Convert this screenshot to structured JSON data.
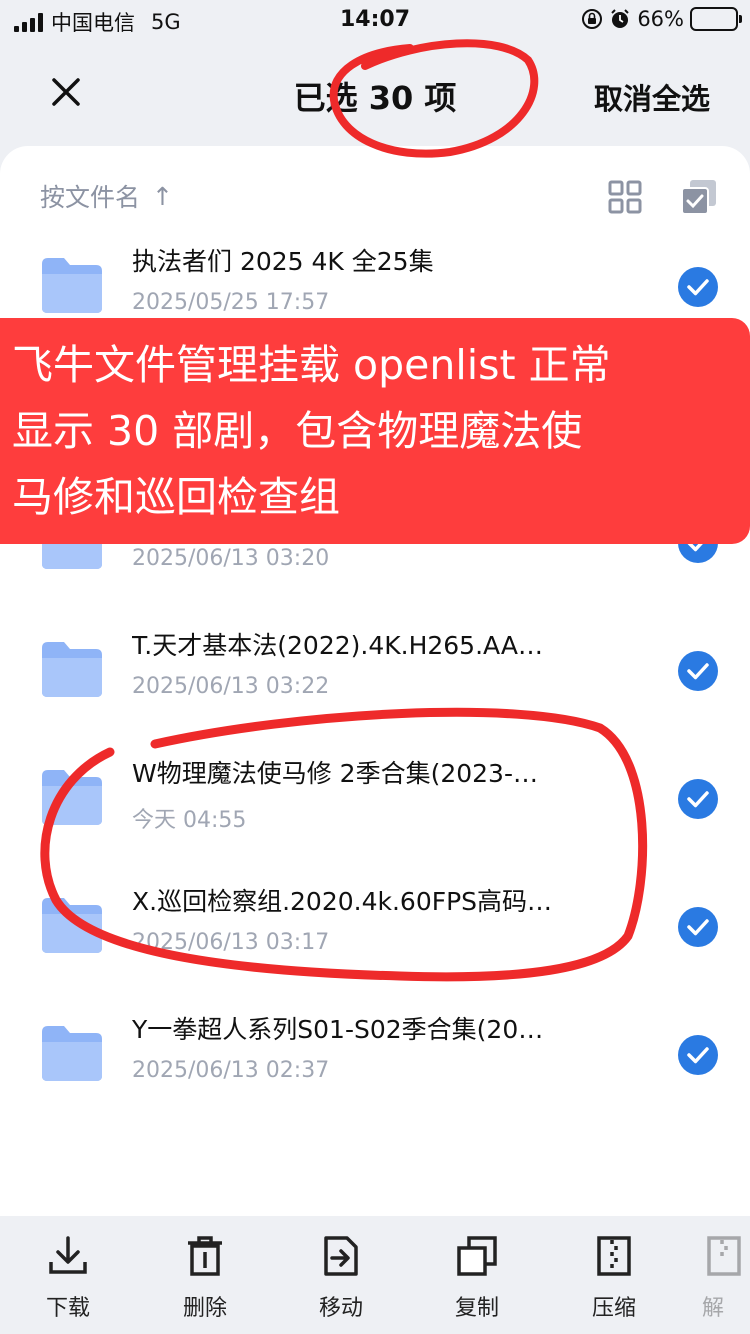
{
  "status": {
    "carrier": "中国电信",
    "network": "5G",
    "time": "14:07",
    "battery": "66%",
    "battery_level": 0.66
  },
  "header": {
    "title": "已选 30 项",
    "cancel_label": "取消全选"
  },
  "sortbar": {
    "label": "按文件名",
    "arrow": "↑"
  },
  "files": [
    {
      "name": "执法者们 2025 4K 全25集",
      "date": "2025/05/25 17:57"
    },
    {
      "name": "",
      "date": "2025/06/13 03:20"
    },
    {
      "name": "T.天才基本法(2022).4K.H265.AA…",
      "date": "2025/06/13 03:22"
    },
    {
      "name": "W物理魔法使马修 2季合集(2023-…",
      "date": "今天 04:55"
    },
    {
      "name": "X.巡回检察组.2020.4k.60FPS高码…",
      "date": "2025/06/13 03:17"
    },
    {
      "name": "Y一拳超人系列S01-S02季合集(20…",
      "date": "2025/06/13 02:37"
    }
  ],
  "banner": {
    "line1": "飞牛文件管理挂载 openlist 正常",
    "line2": "显示 30 部剧，包含物理魔法使",
    "line3": "马修和巡回检查组"
  },
  "toolbar": [
    {
      "label": "下载",
      "icon": "download-icon"
    },
    {
      "label": "删除",
      "icon": "trash-icon"
    },
    {
      "label": "移动",
      "icon": "move-icon"
    },
    {
      "label": "复制",
      "icon": "copy-icon"
    },
    {
      "label": "压缩",
      "icon": "zip-icon"
    },
    {
      "label": "解",
      "icon": "unzip-icon"
    }
  ],
  "colors": {
    "accent": "#2a7ae2",
    "folder": "#8fb4f7",
    "banner": "#fe3d3d",
    "annotation": "#ee2a2a"
  }
}
